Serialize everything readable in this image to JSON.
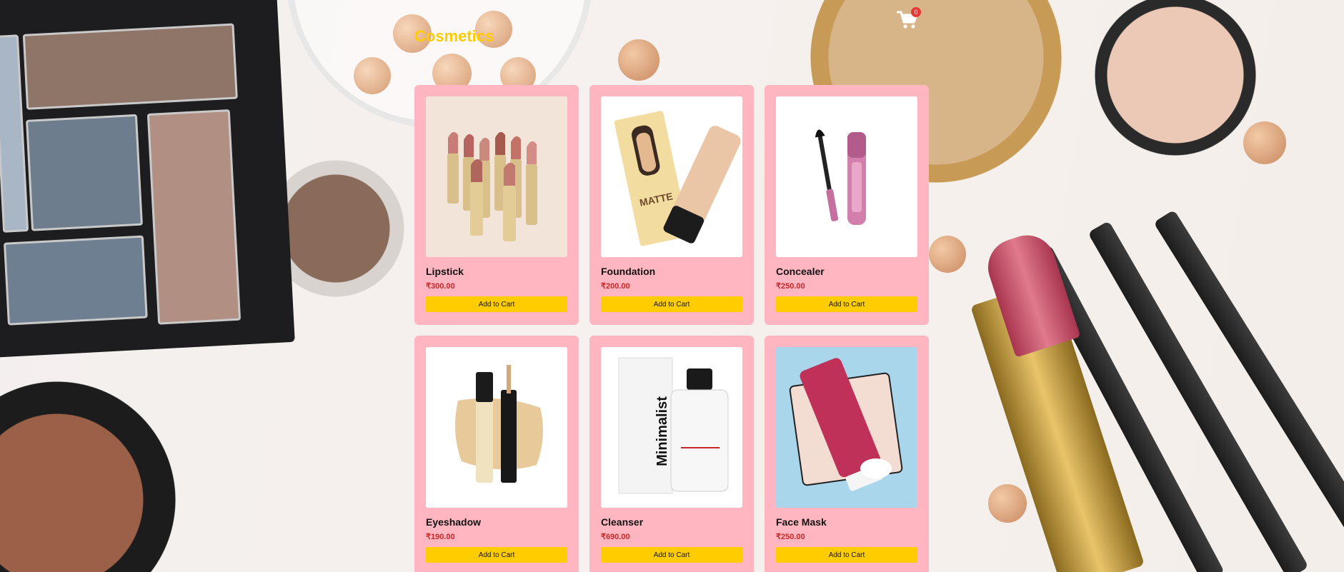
{
  "header": {
    "title": "Cosmetics",
    "cart_count": "0"
  },
  "products": [
    {
      "name": "Lipstick",
      "price": "₹300.00",
      "button": "Add to Cart",
      "icon": "lipstick-image"
    },
    {
      "name": "Foundation",
      "price": "₹200.00",
      "button": "Add to Cart",
      "icon": "foundation-image"
    },
    {
      "name": "Concealer",
      "price": "₹250.00",
      "button": "Add to Cart",
      "icon": "concealer-image"
    },
    {
      "name": "Eyeshadow",
      "price": "₹190.00",
      "button": "Add to Cart",
      "icon": "eyeshadow-image"
    },
    {
      "name": "Cleanser",
      "price": "₹690.00",
      "button": "Add to Cart",
      "icon": "cleanser-image"
    },
    {
      "name": "Face Mask",
      "price": "₹250.00",
      "button": "Add to Cart",
      "icon": "face-mask-image"
    }
  ],
  "product_image_text": {
    "foundation_label": "MATTE",
    "cleanser_label": "Minimalist"
  },
  "colors": {
    "title": "#ffcc00",
    "card_bg": "#ffb6c1",
    "button_bg": "#ffcc00",
    "price": "#c62828",
    "badge": "#e53935"
  }
}
